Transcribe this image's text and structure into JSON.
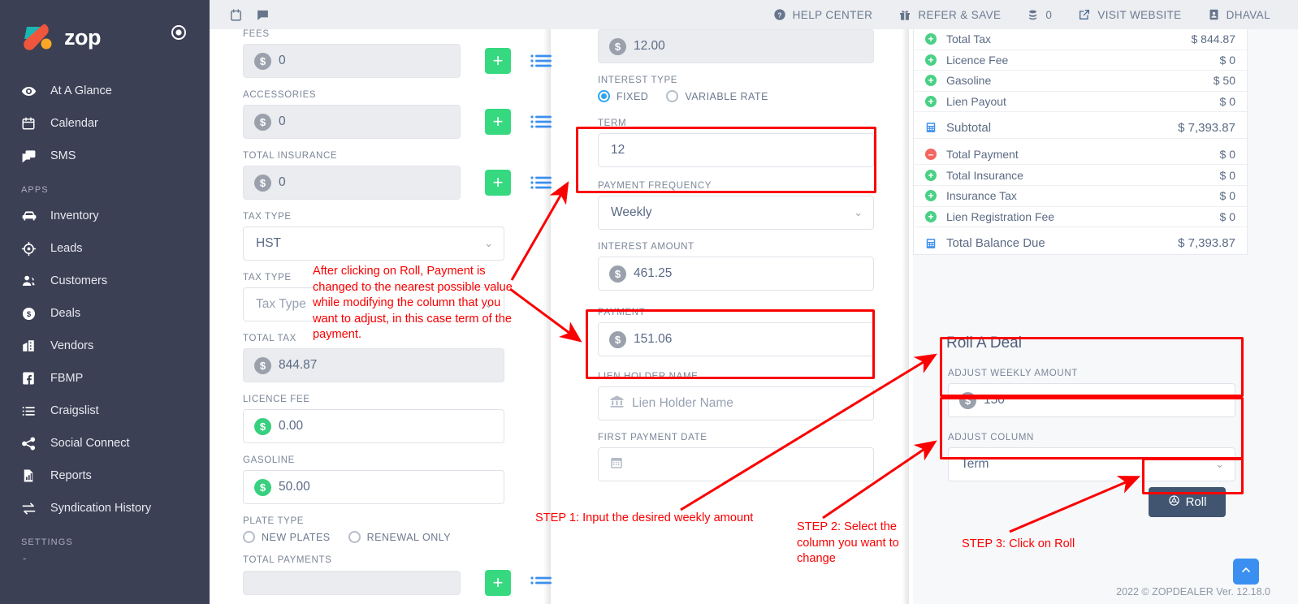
{
  "brand": {
    "name": "zop",
    "target_icon": "target-icon"
  },
  "topbar": {
    "left_icons": [
      {
        "name": "calendar-icon"
      },
      {
        "name": "chat-icon"
      }
    ],
    "items": [
      {
        "icon": "help-circle-icon",
        "label": "HELP CENTER"
      },
      {
        "icon": "gift-icon",
        "label": "REFER & SAVE"
      },
      {
        "icon": "coins-icon",
        "label": "0"
      },
      {
        "icon": "external-link-icon",
        "label": "VISIT WEBSITE"
      },
      {
        "icon": "user-card-icon",
        "label": "DHAVAL"
      }
    ]
  },
  "sidebar": {
    "items": [
      {
        "icon": "eye-icon",
        "label": "At A Glance"
      },
      {
        "icon": "calendar-icon",
        "label": "Calendar"
      },
      {
        "icon": "chat-icon",
        "label": "SMS"
      }
    ],
    "apps_heading": "APPS",
    "apps": [
      {
        "icon": "car-icon",
        "label": "Inventory"
      },
      {
        "icon": "crosshair-icon",
        "label": "Leads"
      },
      {
        "icon": "users-icon",
        "label": "Customers"
      },
      {
        "icon": "dollar-circle-icon",
        "label": "Deals"
      },
      {
        "icon": "building-icon",
        "label": "Vendors"
      },
      {
        "icon": "facebook-icon",
        "label": "FBMP"
      },
      {
        "icon": "list-icon",
        "label": "Craigslist"
      },
      {
        "icon": "share-icon",
        "label": "Social Connect"
      },
      {
        "icon": "report-icon",
        "label": "Reports"
      },
      {
        "icon": "exchange-icon",
        "label": "Syndication History"
      }
    ],
    "settings_heading": "SETTINGS",
    "settings_dash": "-"
  },
  "left_form": {
    "fees": {
      "label": "FEES",
      "value": "0"
    },
    "accessories": {
      "label": "ACCESSORIES",
      "value": "0"
    },
    "total_insurance": {
      "label": "TOTAL INSURANCE",
      "value": "0"
    },
    "tax_type_1": {
      "label": "TAX TYPE",
      "value": "HST"
    },
    "tax_type_2": {
      "label": "TAX TYPE",
      "placeholder": "Tax Type"
    },
    "total_tax": {
      "label": "TOTAL TAX",
      "value": "844.87"
    },
    "licence_fee": {
      "label": "LICENCE FEE",
      "value": "0.00"
    },
    "gasoline": {
      "label": "GASOLINE",
      "value": "50.00"
    },
    "plate_type": {
      "label": "PLATE TYPE",
      "options": [
        {
          "label": "NEW PLATES",
          "selected": false
        },
        {
          "label": "RENEWAL ONLY",
          "selected": false
        }
      ]
    },
    "total_payments": {
      "label": "TOTAL PAYMENTS"
    }
  },
  "mid_form": {
    "top_amount": {
      "value": "12.00"
    },
    "interest_type": {
      "label": "INTEREST TYPE",
      "options": [
        {
          "label": "FIXED",
          "selected": true
        },
        {
          "label": "VARIABLE RATE",
          "selected": false
        }
      ]
    },
    "term": {
      "label": "TERM",
      "value": "12"
    },
    "payment_frequency": {
      "label": "PAYMENT FREQUENCY",
      "value": "Weekly"
    },
    "interest_amount": {
      "label": "INTEREST AMOUNT",
      "value": "461.25"
    },
    "payment": {
      "label": "PAYMENT",
      "value": "151.06"
    },
    "lien_holder_name": {
      "label": "LIEN HOLDER NAME",
      "placeholder": "Lien Holder Name"
    },
    "first_payment_date": {
      "label": "FIRST PAYMENT DATE",
      "value": ""
    }
  },
  "summary": {
    "rows": [
      {
        "icon": "plus-circle-icon",
        "name": "Total Tax",
        "value": "$ 844.87"
      },
      {
        "icon": "plus-circle-icon",
        "name": "Licence Fee",
        "value": "$ 0"
      },
      {
        "icon": "plus-circle-icon",
        "name": "Gasoline",
        "value": "$ 50"
      },
      {
        "icon": "plus-circle-icon",
        "name": "Lien Payout",
        "value": "$ 0"
      },
      {
        "icon": "calculator-icon",
        "name": "Subtotal",
        "value": "$ 7,393.87"
      },
      {
        "icon": "minus-circle-icon",
        "name": "Total Payment",
        "value": "$ 0"
      },
      {
        "icon": "plus-circle-icon",
        "name": "Total Insurance",
        "value": "$ 0"
      },
      {
        "icon": "plus-circle-icon",
        "name": "Insurance Tax",
        "value": "$ 0"
      },
      {
        "icon": "plus-circle-icon",
        "name": "Lien Registration Fee",
        "value": "$ 0"
      },
      {
        "icon": "calculator-icon",
        "name": "Total Balance Due",
        "value": "$ 7,393.87"
      }
    ]
  },
  "roll": {
    "title": "Roll A Deal",
    "adjust_amount": {
      "label": "ADJUST WEEKLY AMOUNT",
      "value": "150"
    },
    "adjust_column": {
      "label": "ADJUST COLUMN",
      "value": "Term"
    },
    "button": {
      "icon": "steering-wheel-icon",
      "label": "Roll"
    }
  },
  "annotations": {
    "note_main": "After clicking on Roll, Payment is changed to the nearest possible value while modifying the column that you want to adjust, in this case term of the payment.",
    "step1": "STEP 1: Input the desired weekly amount",
    "step2": "STEP 2: Select the column you want to change",
    "step3": "STEP 3: Click on Roll"
  },
  "footer": {
    "text": "2022 © ZOPDEALER Ver. 12.18.0"
  },
  "scroll_top": {
    "icon": "chevron-up-icon"
  },
  "colors": {
    "sidebar_bg": "#3c4055",
    "accent_green": "#36d97f",
    "accent_blue": "#3b8ff0",
    "annotation_red": "#fb0000",
    "roll_button": "#415571",
    "logo_teal": "#1bb6b1",
    "logo_red": "#f0563d",
    "logo_orange": "#f9a825"
  }
}
